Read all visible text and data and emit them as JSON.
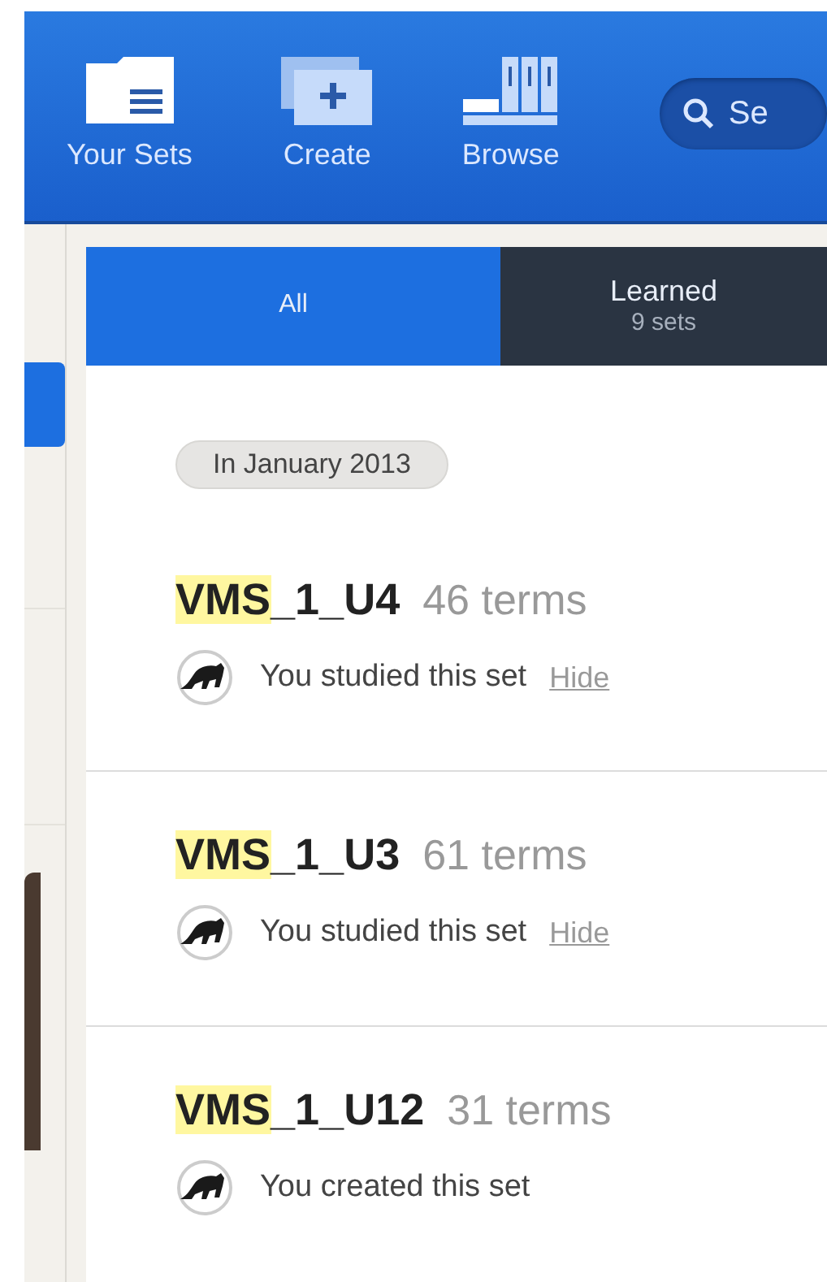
{
  "nav": [
    {
      "kind": "folder",
      "label": "Your Sets"
    },
    {
      "kind": "create",
      "label": "Create"
    },
    {
      "kind": "browse",
      "label": "Browse"
    }
  ],
  "search": {
    "placeholder": "Se"
  },
  "sidebar": {
    "items": [
      {
        "selected": true
      },
      {
        "selected": false
      },
      {
        "selected": false
      }
    ],
    "photo": true
  },
  "tabs": [
    {
      "label": "All",
      "selected": true
    },
    {
      "label": "Learned",
      "count": "9 sets",
      "selected": false
    }
  ],
  "date_group": "In January 2013",
  "sets": [
    {
      "match": "VMS",
      "title_rest": "_1_U4",
      "terms": "46 terms",
      "activity": "You studied this set",
      "hide": "Hide"
    },
    {
      "match": "VMS",
      "title_rest": "_1_U3",
      "terms": "61 terms",
      "activity": "You studied this set",
      "hide": "Hide"
    },
    {
      "match": "VMS",
      "title_rest": "_1_U12",
      "terms": "31 terms",
      "activity": "You created this set"
    }
  ]
}
